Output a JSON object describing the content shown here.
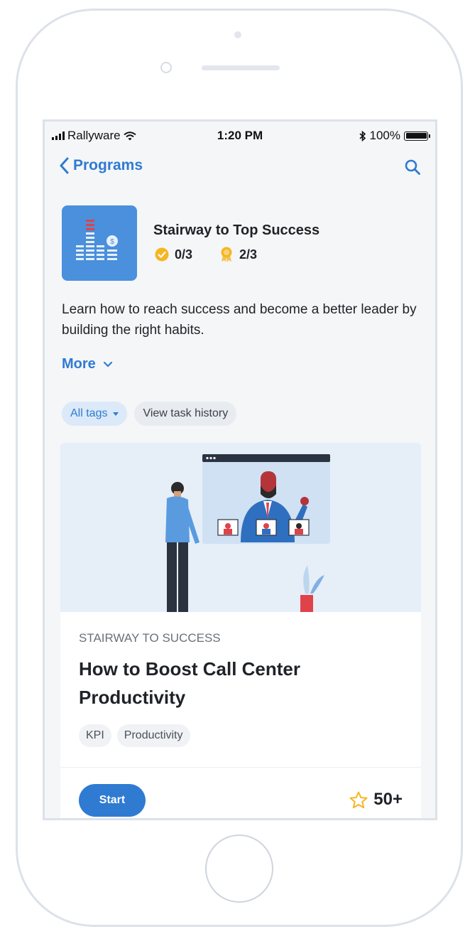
{
  "status_bar": {
    "carrier": "Rallyware",
    "time": "1:20 PM",
    "battery": "100%"
  },
  "nav": {
    "back_label": "Programs"
  },
  "program": {
    "title": "Stairway to Top Success",
    "completed": "0/3",
    "badges": "2/3",
    "description": "Learn how to reach success and become a better leader by building the right habits.",
    "more_label": "More"
  },
  "filters": {
    "all_tags": "All tags",
    "history": "View task history"
  },
  "card": {
    "kicker": "STAIRWAY TO SUCCESS",
    "title": "How to Boost Call Center Productivity",
    "tags": [
      "KPI",
      "Productivity"
    ],
    "start_label": "Start",
    "points": "50+"
  },
  "colors": {
    "accent": "#2f7bd1",
    "check": "#f5b623"
  }
}
